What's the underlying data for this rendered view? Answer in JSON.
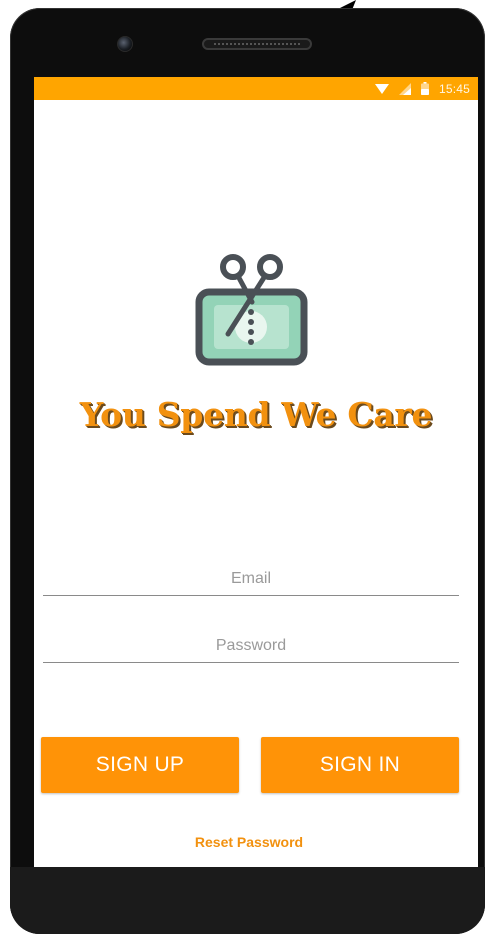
{
  "status_bar": {
    "time": "15:45",
    "background": "#ffa500",
    "icons": [
      "wifi-icon",
      "signal-icon",
      "battery-icon"
    ]
  },
  "brand": {
    "title": "You Spend We Care",
    "logo_icon": "scissors-money-icon",
    "accent": "#f2910f"
  },
  "form": {
    "email_placeholder": "Email",
    "email_value": "",
    "password_placeholder": "Password",
    "password_value": ""
  },
  "actions": {
    "signup_label": "SIGN UP",
    "signin_label": "SIGN IN",
    "reset_label": "Reset Password",
    "button_color": "#ff9307"
  }
}
